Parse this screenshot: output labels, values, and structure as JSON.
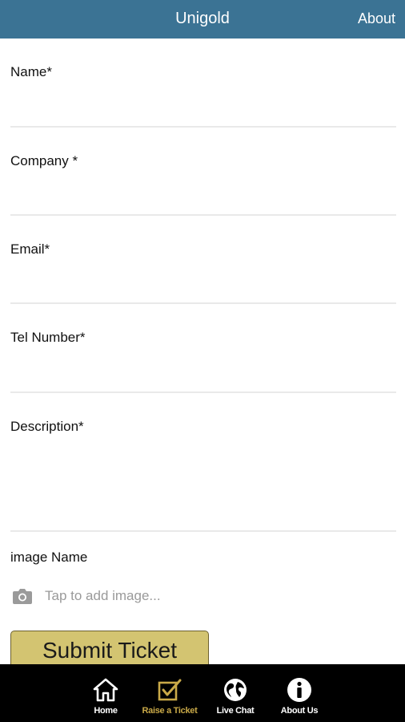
{
  "header": {
    "title": "Unigold",
    "about_label": "About"
  },
  "form": {
    "name_label": "Name*",
    "company_label": "Company *",
    "email_label": "Email*",
    "tel_label": "Tel Number*",
    "description_label": "Description*",
    "image_label": "image Name",
    "image_placeholder": "Tap to add image...",
    "submit_label": "Submit Ticket"
  },
  "tabs": [
    {
      "label": "Home",
      "icon": "home-icon"
    },
    {
      "label": "Raise a Ticket",
      "icon": "checkbox-icon",
      "active": true
    },
    {
      "label": "Live Chat",
      "icon": "globe-icon"
    },
    {
      "label": "About Us",
      "icon": "info-icon"
    }
  ],
  "colors": {
    "header_bg": "#3b7394",
    "tabbar_bg": "#000000",
    "active_tab": "#c9a948",
    "submit_bg": "#d3c471"
  }
}
